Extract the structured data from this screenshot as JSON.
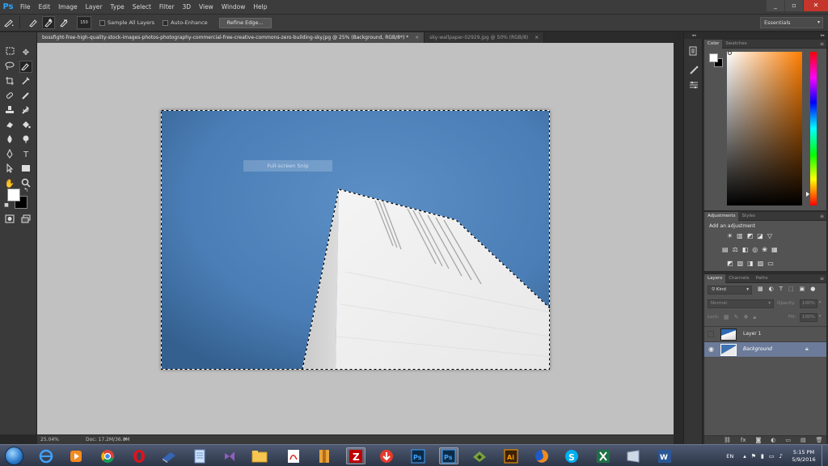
{
  "app": {
    "logo": "Ps"
  },
  "menu": [
    "File",
    "Edit",
    "Image",
    "Layer",
    "Type",
    "Select",
    "Filter",
    "3D",
    "View",
    "Window",
    "Help"
  ],
  "window_controls": {
    "minimize": "_",
    "restore": "▫",
    "close": "✕"
  },
  "options_bar": {
    "brush_size": "150",
    "sample_all_layers": "Sample All Layers",
    "auto_enhance": "Auto-Enhance",
    "refine_edge": "Refine Edge...",
    "workspace": "Essentials"
  },
  "tabs": [
    {
      "label": "bossfight-free-high-quality-stock-images-photos-photography-commercial-free-creative-commons-zero-building-sky.jpg @ 25% (Background, RGB/8*) *",
      "active": true
    },
    {
      "label": "sky-wallpaper-02929.jpg @ 50% (RGB/8)",
      "active": false
    }
  ],
  "canvas": {
    "snip_overlay": "Full-screen Snip"
  },
  "status": {
    "zoom": "25.04%",
    "doc": "Doc: 17.2M/36.8M"
  },
  "color_panel": {
    "tabs": [
      "Color",
      "Swatches"
    ]
  },
  "adjustments_panel": {
    "tabs": [
      "Adjustments",
      "Styles"
    ],
    "heading": "Add an adjustment"
  },
  "layers_panel": {
    "tabs": [
      "Layers",
      "Channels",
      "Paths"
    ],
    "filter": "Kind",
    "blend_mode": "Normal",
    "opacity_label": "Opacity:",
    "opacity_value": "100%",
    "lock_label": "Lock:",
    "fill_label": "Fill:",
    "fill_value": "100%",
    "layers": [
      {
        "name": "Layer 1",
        "visible": false,
        "selected": false
      },
      {
        "name": "Background",
        "visible": true,
        "selected": true
      }
    ]
  },
  "taskbar": {
    "language": "EN",
    "time": "5:15 PM",
    "date": "5/9/2016"
  },
  "colors": {
    "sky": "#4a7db5",
    "building": "#eeeeee",
    "ps_blue": "#2fa3f7",
    "foreground": "#ffffff",
    "background": "#000000"
  }
}
